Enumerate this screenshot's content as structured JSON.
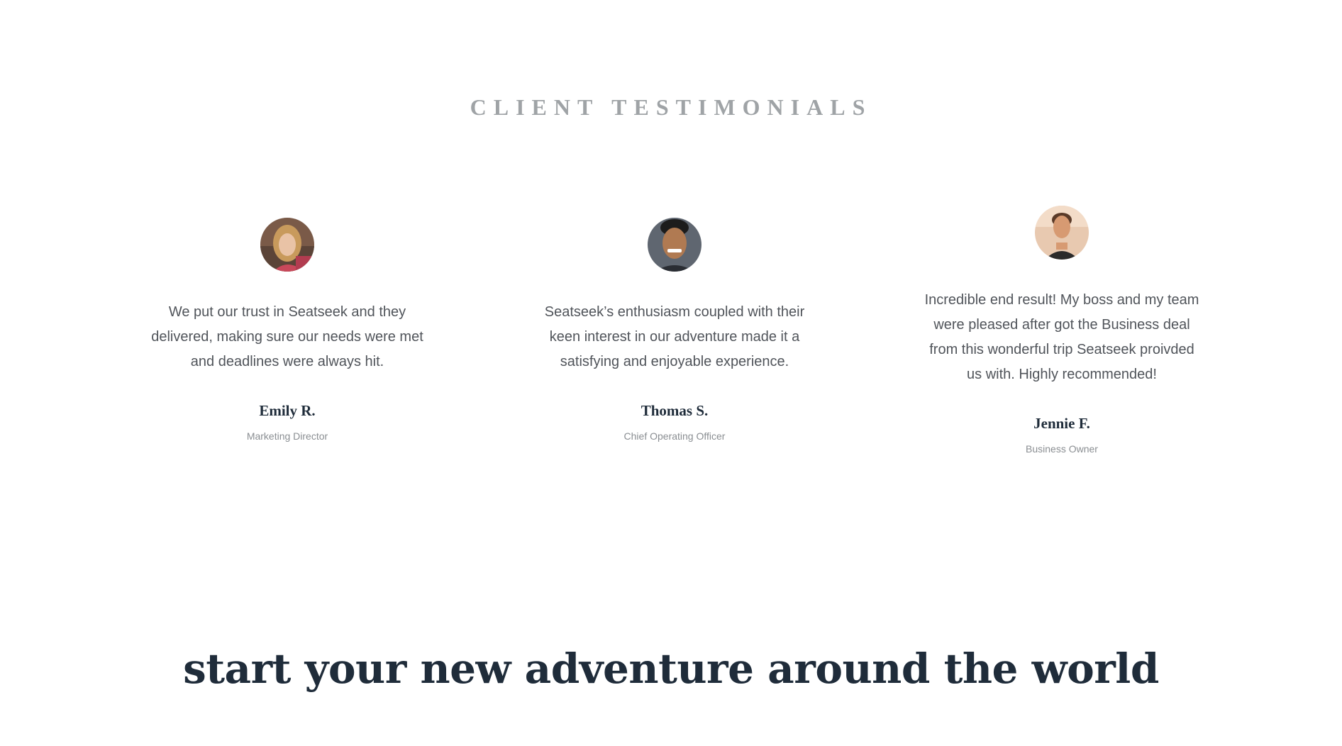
{
  "section": {
    "title": "CLIENT TESTIMONIALS"
  },
  "testimonials": [
    {
      "quote": "We put our trust in Seatseek and they delivered, making sure our needs were met and deadlines were always hit.",
      "name": "Emily R.",
      "role": "Marketing Director"
    },
    {
      "quote": "Seatseek’s enthusiasm coupled with their keen interest in our adventure made it a satisfying and enjoyable experience.",
      "name": "Thomas S.",
      "role": "Chief Operating Officer"
    },
    {
      "quote": "Incredible end result! My boss and my team were pleased after got the Business deal from this wonderful trip Seatseek proivded us with. Highly recommended!",
      "name": "Jennie F.",
      "role": "Business Owner"
    }
  ],
  "cta": {
    "headline": "start your new adventure around the world"
  },
  "colors": {
    "heading": "#1f2c3a",
    "body_text": "#50545a",
    "muted": "#9fa3a6",
    "background": "#ffffff"
  }
}
